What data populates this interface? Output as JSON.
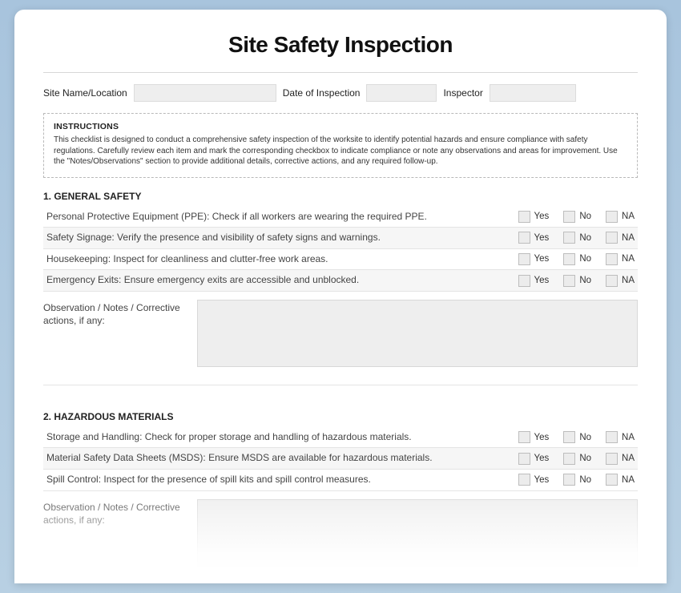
{
  "title": "Site Safety Inspection",
  "header": {
    "siteLabel": "Site Name/Location",
    "dateLabel": "Date of Inspection",
    "inspectorLabel": "Inspector"
  },
  "instructions": {
    "heading": "INSTRUCTIONS",
    "body": "This checklist is designed to conduct a comprehensive safety inspection of the worksite to identify potential hazards and ensure compliance with safety regulations. Carefully review each item and mark the corresponding checkbox to indicate compliance or note any observations and areas for improvement. Use the \"Notes/Observations\" section to provide additional details, corrective actions, and any required follow-up."
  },
  "options": {
    "yes": "Yes",
    "no": "No",
    "na": "NA"
  },
  "notesLabel": "Observation / Notes / Corrective actions, if any:",
  "sections": [
    {
      "title": "1. GENERAL SAFETY",
      "items": [
        "Personal Protective Equipment (PPE): Check if all workers are wearing the required PPE.",
        "Safety Signage: Verify the presence and visibility of safety signs and warnings.",
        "Housekeeping: Inspect for cleanliness and clutter-free work areas.",
        "Emergency Exits: Ensure emergency exits are accessible and unblocked."
      ]
    },
    {
      "title": "2. HAZARDOUS MATERIALS",
      "items": [
        "Storage and Handling: Check for proper storage and handling of hazardous materials.",
        "Material Safety Data Sheets (MSDS): Ensure MSDS are available for hazardous materials.",
        "Spill Control: Inspect for the presence of spill kits and spill control measures."
      ]
    }
  ]
}
